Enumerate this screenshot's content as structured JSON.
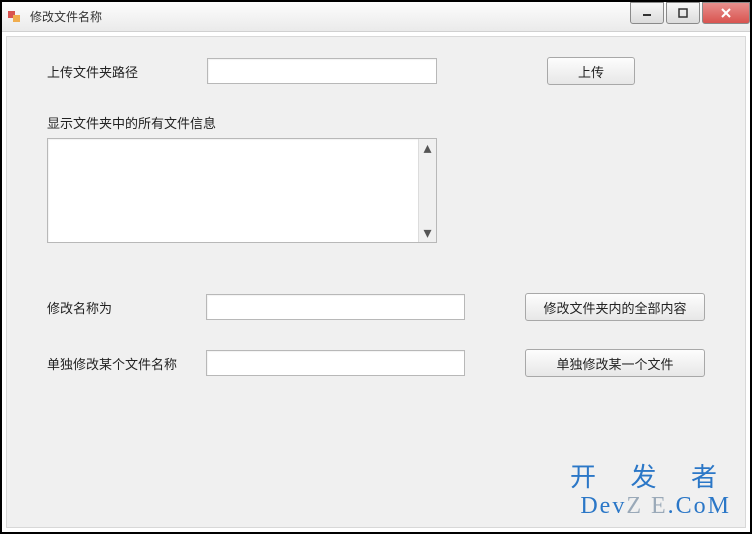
{
  "window": {
    "title": "修改文件名称"
  },
  "labels": {
    "upload_path": "上传文件夹路径",
    "list_info": "显示文件夹中的所有文件信息",
    "rename_to": "修改名称为",
    "single_rename": "单独修改某个文件名称"
  },
  "inputs": {
    "path_value": "",
    "rename_value": "",
    "single_value": ""
  },
  "buttons": {
    "upload": "上传",
    "rename_all": "修改文件夹内的全部内容",
    "rename_single": "单独修改某一个文件"
  },
  "watermark": {
    "cn": "开 发 者",
    "en_prefix": "Dev",
    "en_mid": "Z E",
    "en_suffix": ".CoM"
  }
}
